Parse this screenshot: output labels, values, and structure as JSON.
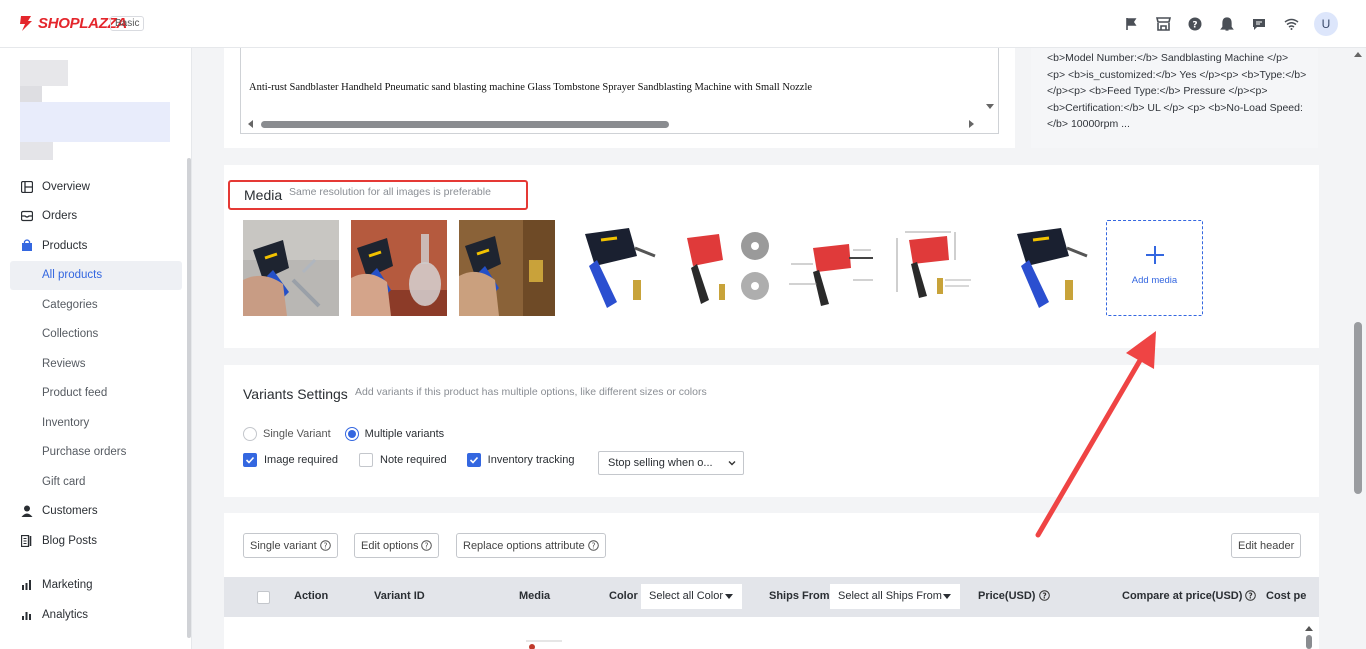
{
  "header": {
    "logo_text": "SHOPLAZZA",
    "plan": "Basic",
    "avatar_initial": "U",
    "icons": [
      "flag-icon",
      "store-icon",
      "help-icon",
      "bell-icon",
      "chat-icon",
      "wifi-icon"
    ]
  },
  "sidebar": {
    "items": [
      {
        "label": "Overview",
        "icon": "overview-icon"
      },
      {
        "label": "Orders",
        "icon": "orders-icon"
      },
      {
        "label": "Products",
        "icon": "products-icon"
      },
      {
        "label": "All products"
      },
      {
        "label": "Categories"
      },
      {
        "label": "Collections"
      },
      {
        "label": "Reviews"
      },
      {
        "label": "Product feed"
      },
      {
        "label": "Inventory"
      },
      {
        "label": "Purchase orders"
      },
      {
        "label": "Gift card"
      },
      {
        "label": "Customers",
        "icon": "customers-icon"
      },
      {
        "label": "Blog Posts",
        "icon": "blog-icon"
      },
      {
        "label": "Marketing",
        "icon": "marketing-icon"
      },
      {
        "label": "Analytics",
        "icon": "analytics-icon"
      }
    ]
  },
  "description": {
    "text": "Anti-rust Sandblaster Handheld Pneumatic sand blasting machine Glass Tombstone Sprayer Sandblasting Machine with Small Nozzle"
  },
  "seo_preview": {
    "text": "<b>Model Number:</b> Sandblasting Machine </p> <p> <b>is_customized:</b> Yes </p><p> <b>Type:</b> </p><p> <b>Feed Type:</b> Pressure </p><p> <b>Certification:</b> UL </p> <p> <b>No-Load Speed:</b> 10000rpm ..."
  },
  "media": {
    "title": "Media",
    "hint": "Same resolution for all images is preferable",
    "add_label": "Add media",
    "image_count": 8
  },
  "variants": {
    "title": "Variants Settings",
    "hint": "Add variants if this product has multiple options, like different sizes or colors",
    "single_label": "Single Variant",
    "multiple_label": "Multiple variants",
    "image_required": "Image required",
    "note_required": "Note required",
    "inventory_tracking": "Inventory tracking",
    "stock_select": "Stop selling when o..."
  },
  "table": {
    "buttons": {
      "single_variant": "Single variant",
      "edit_options": "Edit options",
      "replace_options": "Replace options attribute",
      "edit_header": "Edit header"
    },
    "columns": {
      "action": "Action",
      "variant_id": "Variant ID",
      "media": "Media",
      "color": "Color",
      "color_select": "Select all Color",
      "ships_from": "Ships From",
      "ships_select": "Select all Ships From",
      "price": "Price(USD)",
      "compare_price": "Compare at price(USD)",
      "cost": "Cost pe"
    }
  }
}
